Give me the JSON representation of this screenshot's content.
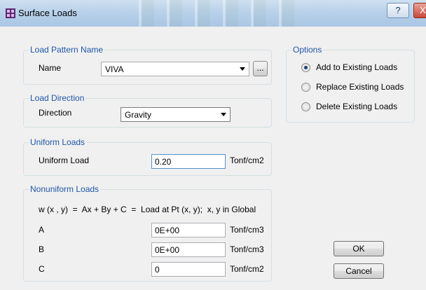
{
  "window": {
    "title": "Surface Loads",
    "help_label": "?",
    "close_label": "X"
  },
  "load_pattern": {
    "group_label": "Load Pattern Name",
    "name_label": "Name",
    "name_value": "VIVA",
    "browse_label": "..."
  },
  "load_direction": {
    "group_label": "Load Direction",
    "direction_label": "Direction",
    "direction_value": "Gravity"
  },
  "uniform": {
    "group_label": "Uniform Loads",
    "load_label": "Uniform Load",
    "load_value": "0.20",
    "unit": "Tonf/cm2"
  },
  "nonuniform": {
    "group_label": "Nonuniform Loads",
    "equation": "w (x , y)  =  Ax + By + C  =  Load at Pt (x, y);  x, y in Global",
    "rows": [
      {
        "label": "A",
        "value": "0E+00",
        "unit": "Tonf/cm3"
      },
      {
        "label": "B",
        "value": "0E+00",
        "unit": "Tonf/cm3"
      },
      {
        "label": "C",
        "value": "0",
        "unit": "Tonf/cm2"
      }
    ]
  },
  "options": {
    "group_label": "Options",
    "items": [
      {
        "label": "Add to Existing Loads",
        "checked": true
      },
      {
        "label": "Replace Existing Loads",
        "checked": false
      },
      {
        "label": "Delete Existing Loads",
        "checked": false
      }
    ]
  },
  "buttons": {
    "ok_label": "OK",
    "cancel_label": "Cancel"
  }
}
